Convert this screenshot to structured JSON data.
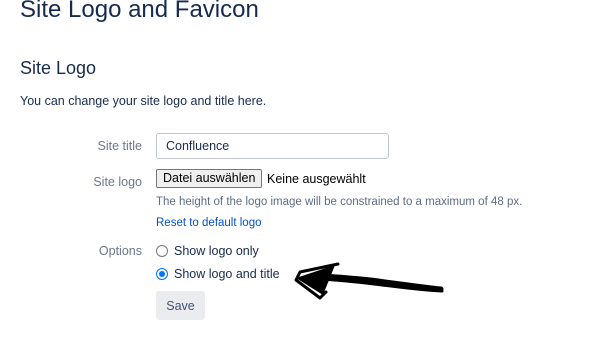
{
  "page": {
    "title": "Site Logo and Favicon"
  },
  "section": {
    "title": "Site Logo",
    "description": "You can change your site logo and title here."
  },
  "form": {
    "site_title_label": "Site title",
    "site_title_value": "Confluence",
    "site_logo_label": "Site logo",
    "file_button_label": "Datei auswählen",
    "file_status": "Keine ausgewählt",
    "help_text": "The height of the logo image will be constrained to a maximum of 48 px.",
    "reset_link": "Reset to default logo",
    "options_label": "Options",
    "options": [
      {
        "label": "Show logo only",
        "checked": false
      },
      {
        "label": "Show logo and title",
        "checked": true
      }
    ],
    "save_label": "Save"
  },
  "colors": {
    "heading": "#172b4d",
    "label": "#6b778c",
    "link": "#0052cc",
    "radio_accent": "#0075ff",
    "button_bg": "#ebecf0"
  }
}
